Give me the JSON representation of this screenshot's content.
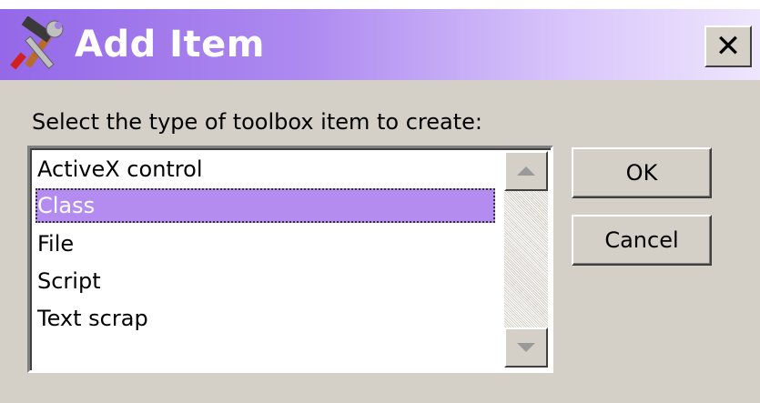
{
  "window": {
    "title": "Add Item",
    "close_label": "✕",
    "title_gradient_start": "#9468e8",
    "title_gradient_end": "#eee6fd"
  },
  "prompt": "Select the type of toolbox item to create:",
  "list": {
    "items": [
      {
        "label": "ActiveX control",
        "selected": false
      },
      {
        "label": "Class",
        "selected": true
      },
      {
        "label": "File",
        "selected": false
      },
      {
        "label": "Script",
        "selected": false
      },
      {
        "label": "Text scrap",
        "selected": false
      }
    ],
    "selection_color": "#b48cf0"
  },
  "buttons": {
    "ok_label": "OK",
    "cancel_label": "Cancel"
  },
  "icons": {
    "app": "tools-icon",
    "scroll_up": "up-arrow-icon",
    "scroll_down": "down-arrow-icon"
  }
}
